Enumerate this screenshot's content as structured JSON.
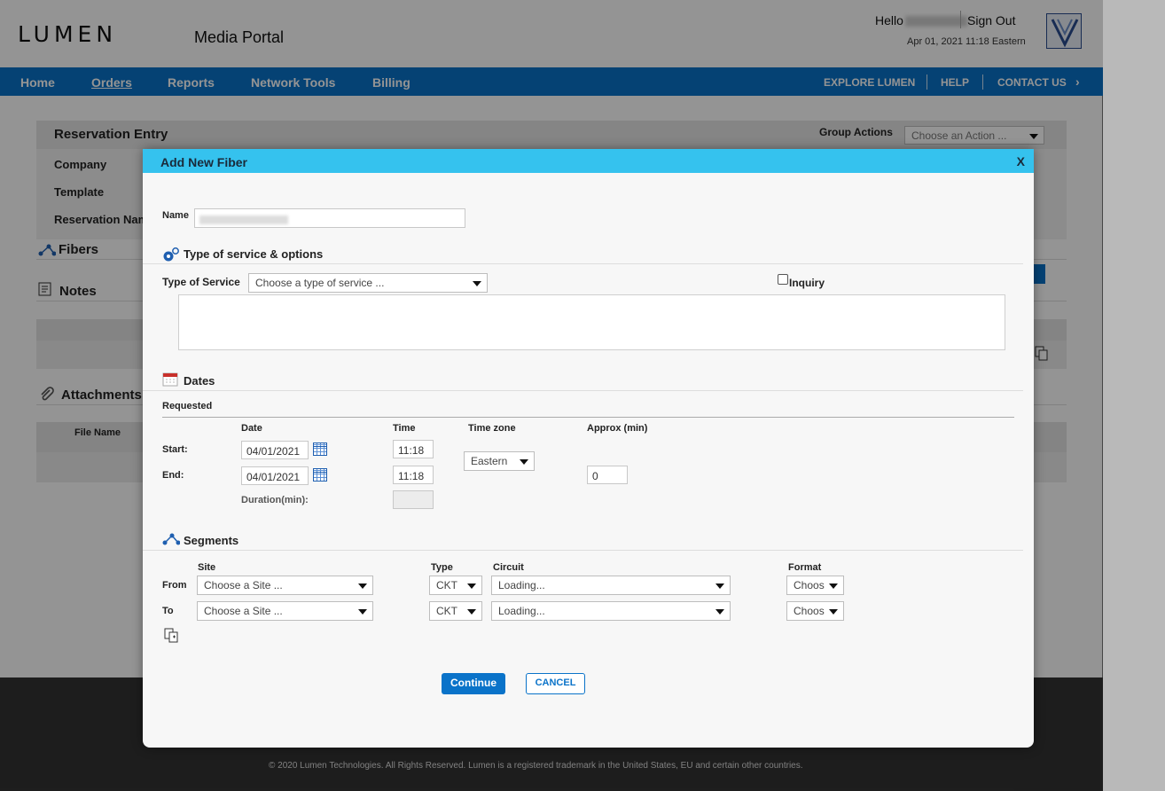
{
  "header": {
    "logo": "LUMEN",
    "portal_title": "Media Portal",
    "hello": "Hello",
    "sign_out": "Sign Out",
    "datetime": "Apr 01, 2021 11:18 Eastern"
  },
  "nav": {
    "items": [
      "Home",
      "Orders",
      "Reports",
      "Network Tools",
      "Billing"
    ],
    "right_items": [
      "EXPLORE LUMEN",
      "HELP",
      "CONTACT US"
    ],
    "active": "Orders"
  },
  "background": {
    "reservation_entry": "Reservation Entry",
    "group_actions": "Group Actions",
    "group_actions_placeholder": "Choose an Action ...",
    "company": "Company",
    "template": "Template",
    "reservation_name": "Reservation Name",
    "fibers": "Fibers",
    "notes": "Notes",
    "attachments": "Attachments",
    "file_name": "File Name",
    "footer": "© 2020 Lumen Technologies. All Rights Reserved. Lumen is a registered trademark in the United States, EU and certain other countries."
  },
  "modal": {
    "title": "Add New Fiber",
    "close": "X",
    "name_label": "Name",
    "service": {
      "section": "Type of service & options",
      "label": "Type of Service",
      "placeholder": "Choose a type of service ...",
      "inquiry": "Inquiry"
    },
    "dates": {
      "section": "Dates",
      "requested": "Requested",
      "col_date": "Date",
      "col_time": "Time",
      "col_timezone": "Time zone",
      "col_approx": "Approx (min)",
      "start_label": "Start:",
      "end_label": "End:",
      "start_date": "04/01/2021",
      "end_date": "04/01/2021",
      "start_time": "11:18",
      "end_time": "11:18",
      "timezone": "Eastern",
      "approx": "0",
      "duration_label": "Duration(min):"
    },
    "segments": {
      "section": "Segments",
      "col_site": "Site",
      "col_type": "Type",
      "col_circuit": "Circuit",
      "col_format": "Format",
      "from_label": "From",
      "to_label": "To",
      "site_placeholder": "Choose a Site ...",
      "type_value": "CKT",
      "circuit_value": "Loading...",
      "format_value": "Choos"
    },
    "continue": "Continue",
    "cancel": "CANCEL"
  }
}
